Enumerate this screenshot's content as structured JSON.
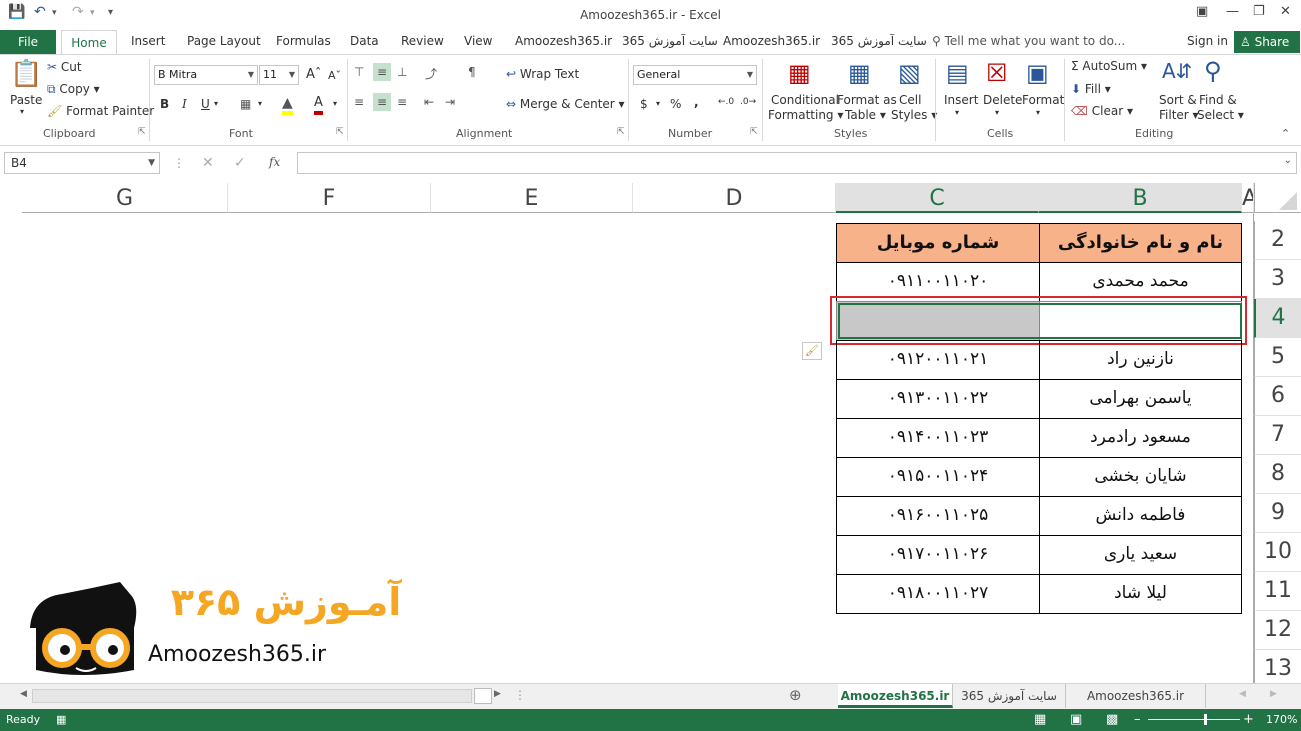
{
  "window": {
    "title": "Amoozesh365.ir - Excel"
  },
  "tabs": [
    "File",
    "Home",
    "Insert",
    "Page Layout",
    "Formulas",
    "Data",
    "Review",
    "View",
    "Amoozesh365.ir",
    "سایت آموزش 365",
    "Amoozesh365.ir",
    "سایت آموزش 365"
  ],
  "tell_me": "Tell me what you want to do...",
  "signin": "Sign in",
  "share": "Share",
  "clipboard": {
    "paste": "Paste",
    "cut": "Cut",
    "copy": "Copy",
    "format_painter": "Format Painter",
    "label": "Clipboard"
  },
  "font": {
    "name": "B Mitra",
    "size": "11",
    "label": "Font",
    "bold": "B",
    "italic": "I",
    "underline": "U"
  },
  "alignment": {
    "wrap": "Wrap Text",
    "merge": "Merge & Center",
    "label": "Alignment"
  },
  "number": {
    "format": "General",
    "label": "Number",
    "currency": "$",
    "percent": "%",
    "comma": ","
  },
  "styles": {
    "conditional": "Conditional",
    "formatting": "Formatting",
    "format_as": "Format as",
    "table": "Table",
    "cell": "Cell",
    "cell_styles": "Styles",
    "label": "Styles"
  },
  "cells": {
    "insert": "Insert",
    "delete": "Delete",
    "format": "Format",
    "label": "Cells"
  },
  "editing": {
    "autosum": "AutoSum",
    "fill": "Fill",
    "clear": "Clear",
    "sort": "Sort &",
    "filter": "Filter",
    "find": "Find &",
    "select": "Select",
    "label": "Editing"
  },
  "formula_bar": {
    "name_box": "B4",
    "fx": "fx"
  },
  "columns": [
    "G",
    "F",
    "E",
    "D",
    "C",
    "B",
    "A"
  ],
  "rows": [
    "2",
    "3",
    "4",
    "5",
    "6",
    "7",
    "8",
    "9",
    "10",
    "11",
    "12",
    "13"
  ],
  "table": {
    "header": {
      "name": "نام و نام خانوادگی",
      "phone": "شماره موبایل"
    },
    "data": [
      {
        "name": "محمد محمدی",
        "phone": "۰۹۱۱۰۰۱۱۰۲۰"
      },
      {
        "name": "",
        "phone": ""
      },
      {
        "name": "نازنین راد",
        "phone": "۰۹۱۲۰۰۱۱۰۲۱"
      },
      {
        "name": "یاسمن بهرامی",
        "phone": "۰۹۱۳۰۰۱۱۰۲۲"
      },
      {
        "name": "مسعود رادمرد",
        "phone": "۰۹۱۴۰۰۱۱۰۲۳"
      },
      {
        "name": "شایان بخشی",
        "phone": "۰۹۱۵۰۰۱۱۰۲۴"
      },
      {
        "name": "فاطمه دانش",
        "phone": "۰۹۱۶۰۰۱۱۰۲۵"
      },
      {
        "name": "سعید یاری",
        "phone": "۰۹۱۷۰۰۱۱۰۲۶"
      },
      {
        "name": "لیلا شاد",
        "phone": "۰۹۱۸۰۰۱۱۰۲۷"
      }
    ]
  },
  "logo": {
    "fa": "آمـوزش ۳۶۵",
    "url": "Amoozesh365.ir"
  },
  "sheet_tabs": [
    "Amoozesh365.ir",
    "سایت آموزش 365",
    "Amoozesh365.ir"
  ],
  "status": {
    "ready": "Ready",
    "zoom": "170%"
  },
  "colors": {
    "accent": "#217346",
    "header_fill": "#f7b28a",
    "highlight": "#d9282f",
    "logo_orange": "#f5a623"
  }
}
